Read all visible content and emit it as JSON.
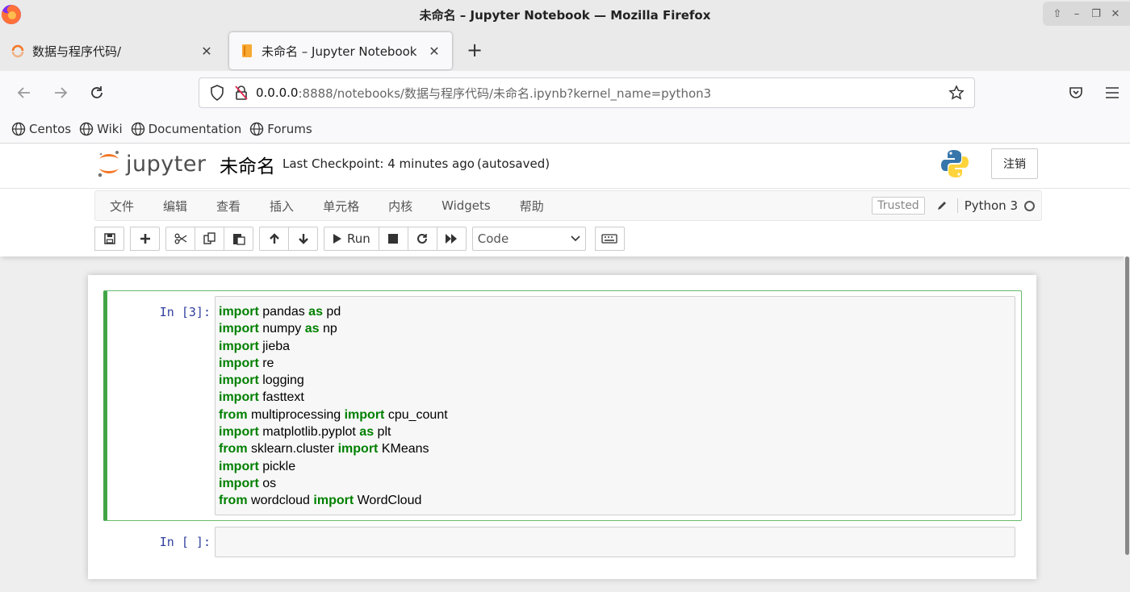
{
  "window": {
    "title": "未命名 – Jupyter Notebook — Mozilla Firefox",
    "controls": [
      "⇧",
      "–",
      "❐",
      "✕"
    ]
  },
  "tabs": [
    {
      "label": "数据与程序代码/",
      "icon": "jupyter-loading-icon",
      "active": false
    },
    {
      "label": "未命名 – Jupyter Notebook",
      "icon": "notebook-icon",
      "active": true
    }
  ],
  "new_tab_label": "+",
  "url": {
    "host": "0.0.0.0",
    "rest": ":8888/notebooks/数据与程序代码/未命名.ipynb?kernel_name=python3"
  },
  "bookmarks": [
    "Centos",
    "Wiki",
    "Documentation",
    "Forums"
  ],
  "jupyter": {
    "logo_text": "jupyter",
    "notebook_name": "未命名",
    "checkpoint": "Last Checkpoint: 4 minutes ago",
    "autosave": "(autosaved)",
    "logout": "注销",
    "menu": [
      "文件",
      "编辑",
      "查看",
      "插入",
      "单元格",
      "内核",
      "Widgets",
      "帮助"
    ],
    "trusted": "Trusted",
    "kernel": "Python 3",
    "run_label": "Run",
    "cell_type": "Code"
  },
  "cells": [
    {
      "prompt": "In [3]:",
      "lines": [
        [
          {
            "t": "import",
            "k": true
          },
          {
            "t": " pandas "
          },
          {
            "t": "as",
            "k": true
          },
          {
            "t": " pd"
          }
        ],
        [
          {
            "t": "import",
            "k": true
          },
          {
            "t": " numpy "
          },
          {
            "t": "as",
            "k": true
          },
          {
            "t": " np"
          }
        ],
        [
          {
            "t": "import",
            "k": true
          },
          {
            "t": " jieba"
          }
        ],
        [
          {
            "t": "import",
            "k": true
          },
          {
            "t": " re"
          }
        ],
        [
          {
            "t": "import",
            "k": true
          },
          {
            "t": " logging"
          }
        ],
        [
          {
            "t": "import",
            "k": true
          },
          {
            "t": " fasttext"
          }
        ],
        [
          {
            "t": "from",
            "k": true
          },
          {
            "t": " multiprocessing "
          },
          {
            "t": "import",
            "k": true
          },
          {
            "t": " cpu_count"
          }
        ],
        [
          {
            "t": "import",
            "k": true
          },
          {
            "t": " matplotlib.pyplot "
          },
          {
            "t": "as",
            "k": true
          },
          {
            "t": " plt"
          }
        ],
        [
          {
            "t": "from",
            "k": true
          },
          {
            "t": " sklearn.cluster "
          },
          {
            "t": "import",
            "k": true
          },
          {
            "t": " KMeans"
          }
        ],
        [
          {
            "t": "import",
            "k": true
          },
          {
            "t": " pickle"
          }
        ],
        [
          {
            "t": "import",
            "k": true
          },
          {
            "t": " os"
          }
        ],
        [
          {
            "t": "from",
            "k": true
          },
          {
            "t": " wordcloud "
          },
          {
            "t": "import",
            "k": true
          },
          {
            "t": " WordCloud"
          }
        ]
      ]
    },
    {
      "prompt": "In [ ]:",
      "lines": []
    }
  ],
  "colors": {
    "keyword": "#008000",
    "prompt": "#303f9f",
    "selected_border": "#42a545"
  }
}
